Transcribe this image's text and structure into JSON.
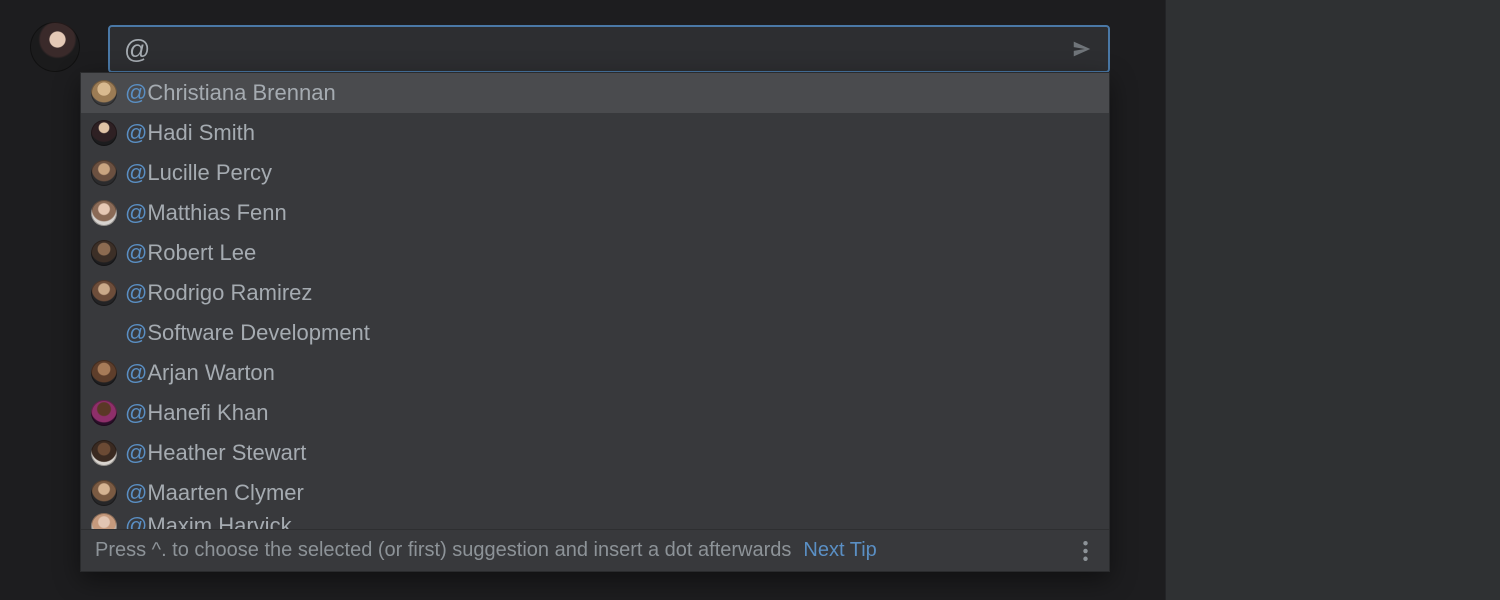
{
  "colors": {
    "accent": "#5a8fc4",
    "input_border": "#4a78a6",
    "bg": "#1d1d1f",
    "popup_bg": "#38393c",
    "highlight_bg": "#4a4b4e",
    "text": "#a5abb1",
    "muted": "#8d9398"
  },
  "compose": {
    "value": "@",
    "placeholder": ""
  },
  "suggestions": [
    {
      "name": "Christiana Brennan",
      "has_avatar": true,
      "highlighted": true
    },
    {
      "name": "Hadi Smith",
      "has_avatar": true,
      "highlighted": false
    },
    {
      "name": "Lucille Percy",
      "has_avatar": true,
      "highlighted": false
    },
    {
      "name": "Matthias Fenn",
      "has_avatar": true,
      "highlighted": false
    },
    {
      "name": "Robert Lee",
      "has_avatar": true,
      "highlighted": false
    },
    {
      "name": "Rodrigo Ramirez",
      "has_avatar": true,
      "highlighted": false
    },
    {
      "name": "Software Development",
      "has_avatar": false,
      "highlighted": false
    },
    {
      "name": "Arjan Warton",
      "has_avatar": true,
      "highlighted": false
    },
    {
      "name": "Hanefi Khan",
      "has_avatar": true,
      "highlighted": false
    },
    {
      "name": "Heather Stewart",
      "has_avatar": true,
      "highlighted": false
    },
    {
      "name": "Maarten Clymer",
      "has_avatar": true,
      "highlighted": false
    },
    {
      "name": "Maxim Harvick",
      "has_avatar": true,
      "highlighted": false,
      "partial": true
    }
  ],
  "tip": {
    "text": "Press ^. to choose the selected (or first) suggestion and insert a dot afterwards",
    "link": "Next Tip"
  }
}
